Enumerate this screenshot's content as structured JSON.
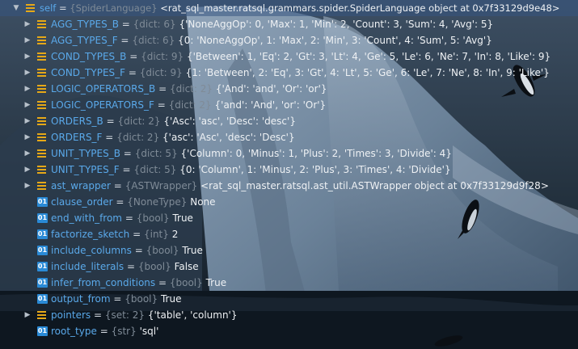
{
  "variables": [
    {
      "name": "self",
      "type": "{SpiderLanguage}",
      "value": "<rat_sql_master.ratsql.grammars.spider.SpiderLanguage object at 0x7f33129d9e48>",
      "expand": "expanded",
      "icon": "var-icon",
      "indent": 0
    },
    {
      "name": "AGG_TYPES_B",
      "type": "{dict: 6}",
      "value": "{'NoneAggOp': 0, 'Max': 1, 'Min': 2, 'Count': 3, 'Sum': 4, 'Avg': 5}",
      "expand": "collapsed",
      "icon": "var-icon",
      "indent": 1
    },
    {
      "name": "AGG_TYPES_F",
      "type": "{dict: 6}",
      "value": "{0: 'NoneAggOp', 1: 'Max', 2: 'Min', 3: 'Count', 4: 'Sum', 5: 'Avg'}",
      "expand": "collapsed",
      "icon": "var-icon",
      "indent": 1
    },
    {
      "name": "COND_TYPES_B",
      "type": "{dict: 9}",
      "value": "{'Between': 1, 'Eq': 2, 'Gt': 3, 'Lt': 4, 'Ge': 5, 'Le': 6, 'Ne': 7, 'In': 8, 'Like': 9}",
      "expand": "collapsed",
      "icon": "var-icon",
      "indent": 1
    },
    {
      "name": "COND_TYPES_F",
      "type": "{dict: 9}",
      "value": "{1: 'Between', 2: 'Eq', 3: 'Gt', 4: 'Lt', 5: 'Ge', 6: 'Le', 7: 'Ne', 8: 'In', 9: 'Like'}",
      "expand": "collapsed",
      "icon": "var-icon",
      "indent": 1
    },
    {
      "name": "LOGIC_OPERATORS_B",
      "type": "{dict: 2}",
      "value": "{'And': 'and', 'Or': 'or'}",
      "expand": "collapsed",
      "icon": "var-icon",
      "indent": 1
    },
    {
      "name": "LOGIC_OPERATORS_F",
      "type": "{dict: 2}",
      "value": "{'and': 'And', 'or': 'Or'}",
      "expand": "collapsed",
      "icon": "var-icon",
      "indent": 1
    },
    {
      "name": "ORDERS_B",
      "type": "{dict: 2}",
      "value": "{'Asc': 'asc', 'Desc': 'desc'}",
      "expand": "collapsed",
      "icon": "var-icon",
      "indent": 1
    },
    {
      "name": "ORDERS_F",
      "type": "{dict: 2}",
      "value": "{'asc': 'Asc', 'desc': 'Desc'}",
      "expand": "collapsed",
      "icon": "var-icon",
      "indent": 1
    },
    {
      "name": "UNIT_TYPES_B",
      "type": "{dict: 5}",
      "value": "{'Column': 0, 'Minus': 1, 'Plus': 2, 'Times': 3, 'Divide': 4}",
      "expand": "collapsed",
      "icon": "var-icon",
      "indent": 1
    },
    {
      "name": "UNIT_TYPES_F",
      "type": "{dict: 5}",
      "value": "{0: 'Column', 1: 'Minus', 2: 'Plus', 3: 'Times', 4: 'Divide'}",
      "expand": "collapsed",
      "icon": "var-icon",
      "indent": 1
    },
    {
      "name": "ast_wrapper",
      "type": "{ASTWrapper}",
      "value": "<rat_sql_master.ratsql.ast_util.ASTWrapper object at 0x7f33129d9f28>",
      "expand": "collapsed",
      "icon": "var-icon",
      "indent": 1
    },
    {
      "name": "clause_order",
      "type": "{NoneType}",
      "value": "None",
      "expand": "none",
      "icon": "primitive-01-icon",
      "indent": 1
    },
    {
      "name": "end_with_from",
      "type": "{bool}",
      "value": "True",
      "expand": "none",
      "icon": "primitive-01-icon",
      "indent": 1
    },
    {
      "name": "factorize_sketch",
      "type": "{int}",
      "value": "2",
      "expand": "none",
      "icon": "primitive-01-icon",
      "indent": 1
    },
    {
      "name": "include_columns",
      "type": "{bool}",
      "value": "True",
      "expand": "none",
      "icon": "primitive-01-icon",
      "indent": 1
    },
    {
      "name": "include_literals",
      "type": "{bool}",
      "value": "False",
      "expand": "none",
      "icon": "primitive-01-icon",
      "indent": 1
    },
    {
      "name": "infer_from_conditions",
      "type": "{bool}",
      "value": "True",
      "expand": "none",
      "icon": "primitive-01-icon",
      "indent": 1
    },
    {
      "name": "output_from",
      "type": "{bool}",
      "value": "True",
      "expand": "none",
      "icon": "primitive-01-icon",
      "indent": 1
    },
    {
      "name": "pointers",
      "type": "{set: 2}",
      "value": "{'table', 'column'}",
      "expand": "collapsed",
      "icon": "var-icon",
      "indent": 1
    },
    {
      "name": "root_type",
      "type": "{str}",
      "value": "'sql'",
      "expand": "none",
      "icon": "primitive-01-icon",
      "indent": 1
    }
  ],
  "labels": {
    "equals": "=",
    "primitive_badge": "01"
  },
  "colors": {
    "name": "#5aa9ea",
    "type": "#7f8b97",
    "value": "#eef1f4",
    "var_icon": "#e6a817",
    "primitive_icon": "#2a8ad6",
    "selection": "#37557f"
  }
}
